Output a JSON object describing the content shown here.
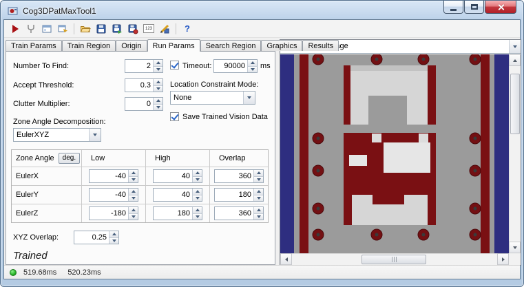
{
  "window": {
    "title": "Cog3DPatMaxTool1"
  },
  "toolbar": {
    "icons": [
      {
        "name": "run-button"
      },
      {
        "name": "electrode-button"
      },
      {
        "name": "tool-window-button"
      },
      {
        "name": "tool-edit-button"
      },
      {
        "name": "open-button"
      },
      {
        "name": "save-button"
      },
      {
        "name": "save-as-button"
      },
      {
        "name": "save-record-button"
      },
      {
        "name": "number-grid-button",
        "label": "123"
      },
      {
        "name": "measure-button"
      },
      {
        "name": "help-button",
        "label": "?"
      }
    ]
  },
  "tabs": {
    "items": [
      "Train Params",
      "Train Region",
      "Origin",
      "Run Params",
      "Search Region",
      "Graphics",
      "Results"
    ],
    "active": "Run Params"
  },
  "run_params": {
    "number_to_find": {
      "label": "Number To Find:",
      "value": "2"
    },
    "accept_threshold": {
      "label": "Accept Threshold:",
      "value": "0.3"
    },
    "clutter_multiplier": {
      "label": "Clutter Multiplier:",
      "value": "0"
    },
    "zone_angle_decomposition": {
      "label": "Zone Angle Decomposition:",
      "value": "EulerXYZ"
    },
    "timeout": {
      "label": "Timeout:",
      "checked": true,
      "value": "90000",
      "unit": "ms"
    },
    "location_constraint_mode": {
      "label": "Location Constraint Mode:",
      "value": "None"
    },
    "save_trained": {
      "label": "Save Trained Vision Data",
      "checked": true
    },
    "zone_table": {
      "headers": [
        "Zone Angle",
        "Low",
        "High",
        "Overlap"
      ],
      "deg_button": "deg.",
      "rows": [
        {
          "name": "EulerX",
          "low": "-40",
          "high": "40",
          "overlap": "360"
        },
        {
          "name": "EulerY",
          "low": "-40",
          "high": "40",
          "overlap": "180"
        },
        {
          "name": "EulerZ",
          "low": "-180",
          "high": "180",
          "overlap": "360"
        }
      ]
    },
    "xyz_overlap": {
      "label": "XYZ Overlap:",
      "value": "0.25"
    },
    "train_status": "Trained"
  },
  "image_panel": {
    "source": "Current.InputImage"
  },
  "status_bar": {
    "run_time": "519.68ms",
    "total_time": "520.23ms"
  },
  "colors": {
    "image_background": "#9b9b9b",
    "image_navy": "#2e2e80",
    "image_maroon": "#7a1013",
    "status_led_green": "#28b428"
  }
}
